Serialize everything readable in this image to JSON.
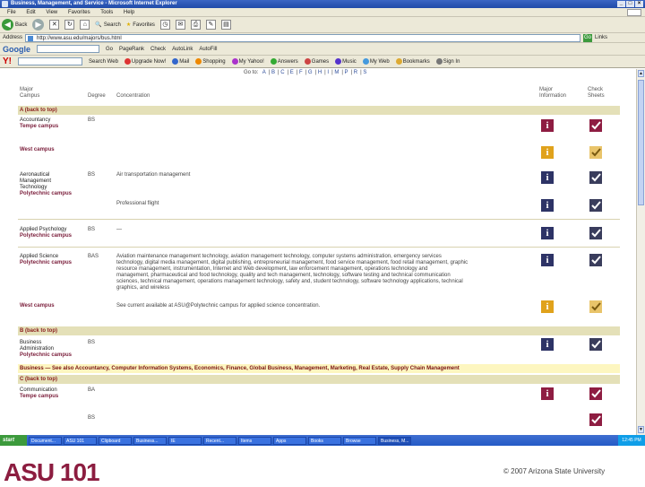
{
  "window": {
    "title": "Business, Management, and Service - Microsoft Internet Explorer",
    "controls": [
      "_",
      "□",
      "×"
    ]
  },
  "menu": [
    "File",
    "Edit",
    "View",
    "Favorites",
    "Tools",
    "Help"
  ],
  "toolbar": {
    "back": "Back",
    "search": "Search",
    "favorites": "Favorites"
  },
  "address": {
    "label": "Address",
    "url": "http://www.asu.edu/majors/bus.html",
    "go": "Go",
    "links": "Links"
  },
  "google": {
    "logo": "Google",
    "buttons": [
      "Go",
      "PageRank",
      "Check",
      "AutoLink",
      "AutoFill"
    ]
  },
  "yahoo": {
    "logo": "Y!",
    "search_label": "Search Web",
    "items": [
      "Upgrade Now!",
      "Mail",
      "Shopping",
      "My Yahoo!",
      "Answers",
      "Games",
      "Music",
      "My Web",
      "Bookmarks",
      "Sign In"
    ]
  },
  "alpha_nav": {
    "label": "Go to:",
    "letters": [
      "A",
      "B",
      "C",
      "E",
      "F",
      "G",
      "H",
      "I",
      "M",
      "P",
      "R",
      "S"
    ]
  },
  "columns": {
    "major": "Major",
    "campus": "Campus",
    "degree": "Degree",
    "concentration": "Concentration",
    "major_info": "Major",
    "major_info2": "Information",
    "check": "Check",
    "check2": "Sheets"
  },
  "sections": {
    "a": "A (back to top)",
    "b": "B (back to top)",
    "c": "C (back to top)"
  },
  "rows": {
    "accountancy": {
      "major": "Accountancy",
      "campus": "Tempe campus",
      "degree": "BS"
    },
    "west": {
      "campus": "West campus"
    },
    "aero": {
      "major1": "Aeronautical",
      "major2": "Management",
      "major3": "Technology",
      "campus": "Polytechnic campus",
      "degree": "BS",
      "conc1": "Air transportation management",
      "conc2": "Professional flight"
    },
    "psych": {
      "major": "Applied Psychology",
      "campus": "Polytechnic campus",
      "degree": "BS",
      "conc": "—"
    },
    "applied": {
      "major": "Applied Science",
      "campus": "Polytechnic campus",
      "degree": "BAS",
      "conc1": "Aviation maintenance management technology, aviation management technology, computer systems administration, emergency services",
      "conc2": "technology, digital media management, digital publishing, entrepreneurial management, food service management, food retail management, graphic",
      "conc3": "resource management, instrumentation, Internet and Web development, law enforcement management, operations technology and",
      "conc4": "management, pharmaceutical and food technology, quality and tech management, technology, software testing and technical communication",
      "conc5": "sciences, technical management, operations management technology, safety and, student technology, software technology applications, technical",
      "conc6": "graphics, and wireless"
    },
    "west2": {
      "campus": "West campus",
      "conc": "See current available at ASU@Polytechnic campus for applied science concentration."
    },
    "biz": {
      "major1": "Business",
      "major2": "Administration",
      "campus": "Polytechnic campus",
      "degree": "BS"
    },
    "bizbar": "Business — See also Accountancy, Computer Information Systems, Economics, Finance, Global Business, Management, Marketing, Real Estate, Supply Chain Management",
    "comm": {
      "major": "Communication",
      "campus": "Tempe campus",
      "degree": "BA"
    },
    "comm2": {
      "degree": "BS"
    }
  },
  "taskbar": {
    "start": "start",
    "tasks": [
      "Document...",
      "ASU 101",
      "Clipboard",
      "Business...",
      "IE",
      "Recent...",
      "Items",
      "Apps",
      "Books",
      "Browse",
      "Business, M..."
    ],
    "tray": "12:45 PM"
  },
  "footer": {
    "logo": "ASU 101",
    "copyright": "© 2007 Arizona State University"
  },
  "colors": {
    "asu_maroon": "#8c1d40",
    "asu_gold": "#e0a21c",
    "section_bar": "#e4e0b8"
  }
}
